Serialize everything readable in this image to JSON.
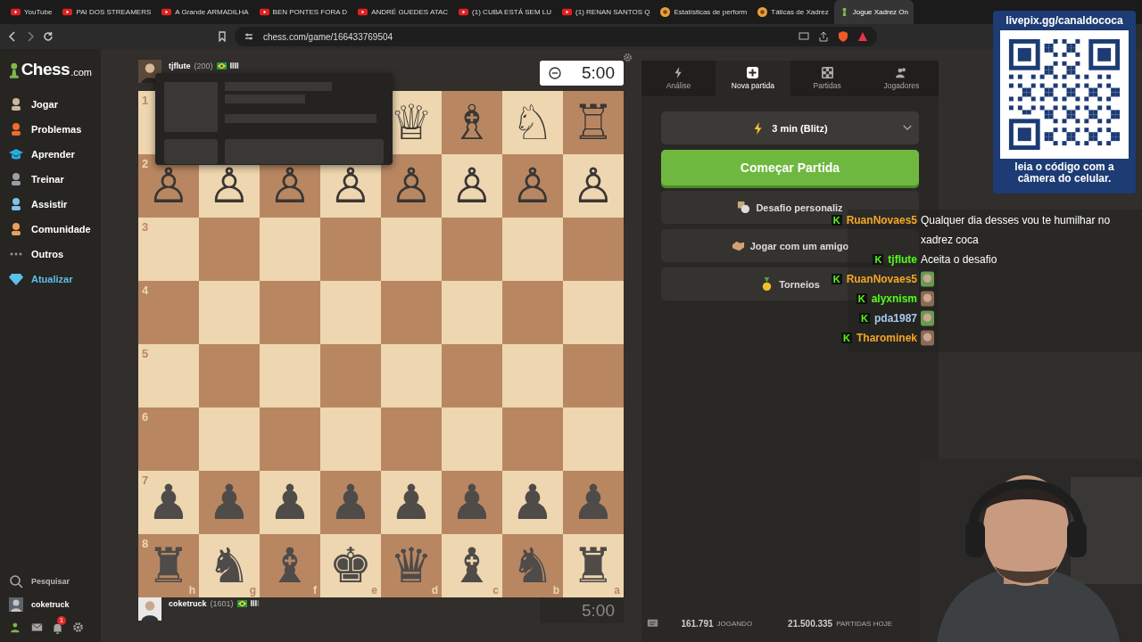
{
  "browser": {
    "tabs": [
      {
        "kind": "youtube",
        "label": "YouTube",
        "selected": false
      },
      {
        "kind": "youtube",
        "label": "PAI DOS STREAMERS",
        "selected": false
      },
      {
        "kind": "youtube",
        "label": "A Grande ARMADILHA",
        "selected": false
      },
      {
        "kind": "youtube",
        "label": "BEN PONTES FORA D",
        "selected": false
      },
      {
        "kind": "youtube",
        "label": "ANDRÉ GUEDES ATAC",
        "selected": false
      },
      {
        "kind": "youtube",
        "label": "(1) CUBA ESTÁ SEM LU",
        "selected": false
      },
      {
        "kind": "youtube",
        "label": "(1) RENAN SANTOS Q",
        "selected": false
      },
      {
        "kind": "chess",
        "label": "Estatísticas de perform",
        "selected": false
      },
      {
        "kind": "chess",
        "label": "Táticas de Xadrez",
        "selected": false
      },
      {
        "kind": "pawn",
        "label": "Jogue Xadrez On",
        "selected": true
      }
    ],
    "url": "chess.com/game/166433769504"
  },
  "sidebar": {
    "logo": {
      "word": "Chess",
      "suffix": ".com"
    },
    "items": [
      {
        "kind": "play",
        "label": "Jogar",
        "color": "#ffffff"
      },
      {
        "kind": "puzzle",
        "label": "Problemas",
        "color": "#ffffff"
      },
      {
        "kind": "learn",
        "label": "Aprender",
        "color": "#ffffff"
      },
      {
        "kind": "train",
        "label": "Treinar",
        "color": "#ffffff"
      },
      {
        "kind": "watch",
        "label": "Assistir",
        "color": "#ffffff"
      },
      {
        "kind": "community",
        "label": "Comunidade",
        "color": "#ffffff"
      },
      {
        "kind": "more",
        "label": "Outros",
        "color": "#ffffff"
      },
      {
        "kind": "upgrade",
        "label": "Atualizar",
        "color": "#5bc0eb"
      }
    ],
    "search": "Pesquisar",
    "user": "coketruck",
    "notifications": "1"
  },
  "game": {
    "top_player": {
      "name": "tjflute",
      "rating": "(200)",
      "clock": "5:00",
      "active": true
    },
    "board": {
      "ranks": [
        {
          "label": "1",
          "squares": [
            "♕",
            "♗",
            "♘",
            "♖"
          ]
        },
        {
          "label": "2",
          "squares": [
            "♙",
            "♙",
            "♙",
            "♙",
            "♙",
            "♙",
            "♙",
            "♙"
          ]
        },
        {
          "label": "3"
        },
        {
          "label": "4"
        },
        {
          "label": "5"
        },
        {
          "label": "6"
        },
        {
          "label": "7",
          "squares": [
            "♟",
            "♟",
            "♟",
            "♟",
            "♟",
            "♟",
            "♟",
            "♟"
          ]
        },
        {
          "label": "8",
          "squares": [
            "♜",
            "♞",
            "♝",
            "♚",
            "♛",
            "♝",
            "♞",
            "♜"
          ]
        }
      ],
      "files": [
        "h",
        "g",
        "f",
        "e",
        "d",
        "c",
        "b",
        "a"
      ]
    },
    "bottom_player": {
      "name": "coketruck",
      "rating": "(1601)",
      "clock": "5:00",
      "active": false
    }
  },
  "panel": {
    "tabs": [
      {
        "kind": "bolt",
        "label": "Análise",
        "selected": false
      },
      {
        "kind": "plus",
        "label": "Nova partida",
        "selected": true
      },
      {
        "kind": "board",
        "label": "Partidas",
        "selected": false
      },
      {
        "kind": "people",
        "label": "Jogadores",
        "selected": false
      }
    ],
    "time_control": "3 min (Blitz)",
    "play_button": "Começar Partida",
    "options": [
      {
        "kind": "custom",
        "label": "Desafio personaliz"
      },
      {
        "kind": "friend",
        "label": "Jogar com um amigo"
      },
      {
        "kind": "medal",
        "label": "Torneios"
      }
    ],
    "stats": [
      {
        "value": "161.791",
        "label": "JOGANDO"
      },
      {
        "value": "21.500.335",
        "label": "PARTIDAS HOJE"
      }
    ]
  },
  "chat": [
    {
      "badge": "K",
      "name": "RuanNovaes5",
      "color": "#f5a623",
      "kind": "text",
      "message": "Qualquer dia desses vou te humilhar no xadrez coca"
    },
    {
      "badge": "K",
      "name": "tjflute",
      "color": "#53fc18",
      "kind": "text",
      "message": "Aceita o desafio"
    },
    {
      "badge": "K",
      "name": "RuanNovaes5",
      "color": "#f5a623",
      "kind": "emote"
    },
    {
      "badge": "K",
      "name": "alyxnism",
      "color": "#53fc18",
      "kind": "emote"
    },
    {
      "badge": "K",
      "name": "pda1987",
      "color": "#a8c8f0",
      "kind": "emote"
    },
    {
      "badge": "K",
      "name": "Tharominek",
      "color": "#f5a623",
      "kind": "emote"
    }
  ],
  "qr": {
    "url": "livepix.gg/canaldococa",
    "caption": "leia o código com a câmera do celular."
  }
}
